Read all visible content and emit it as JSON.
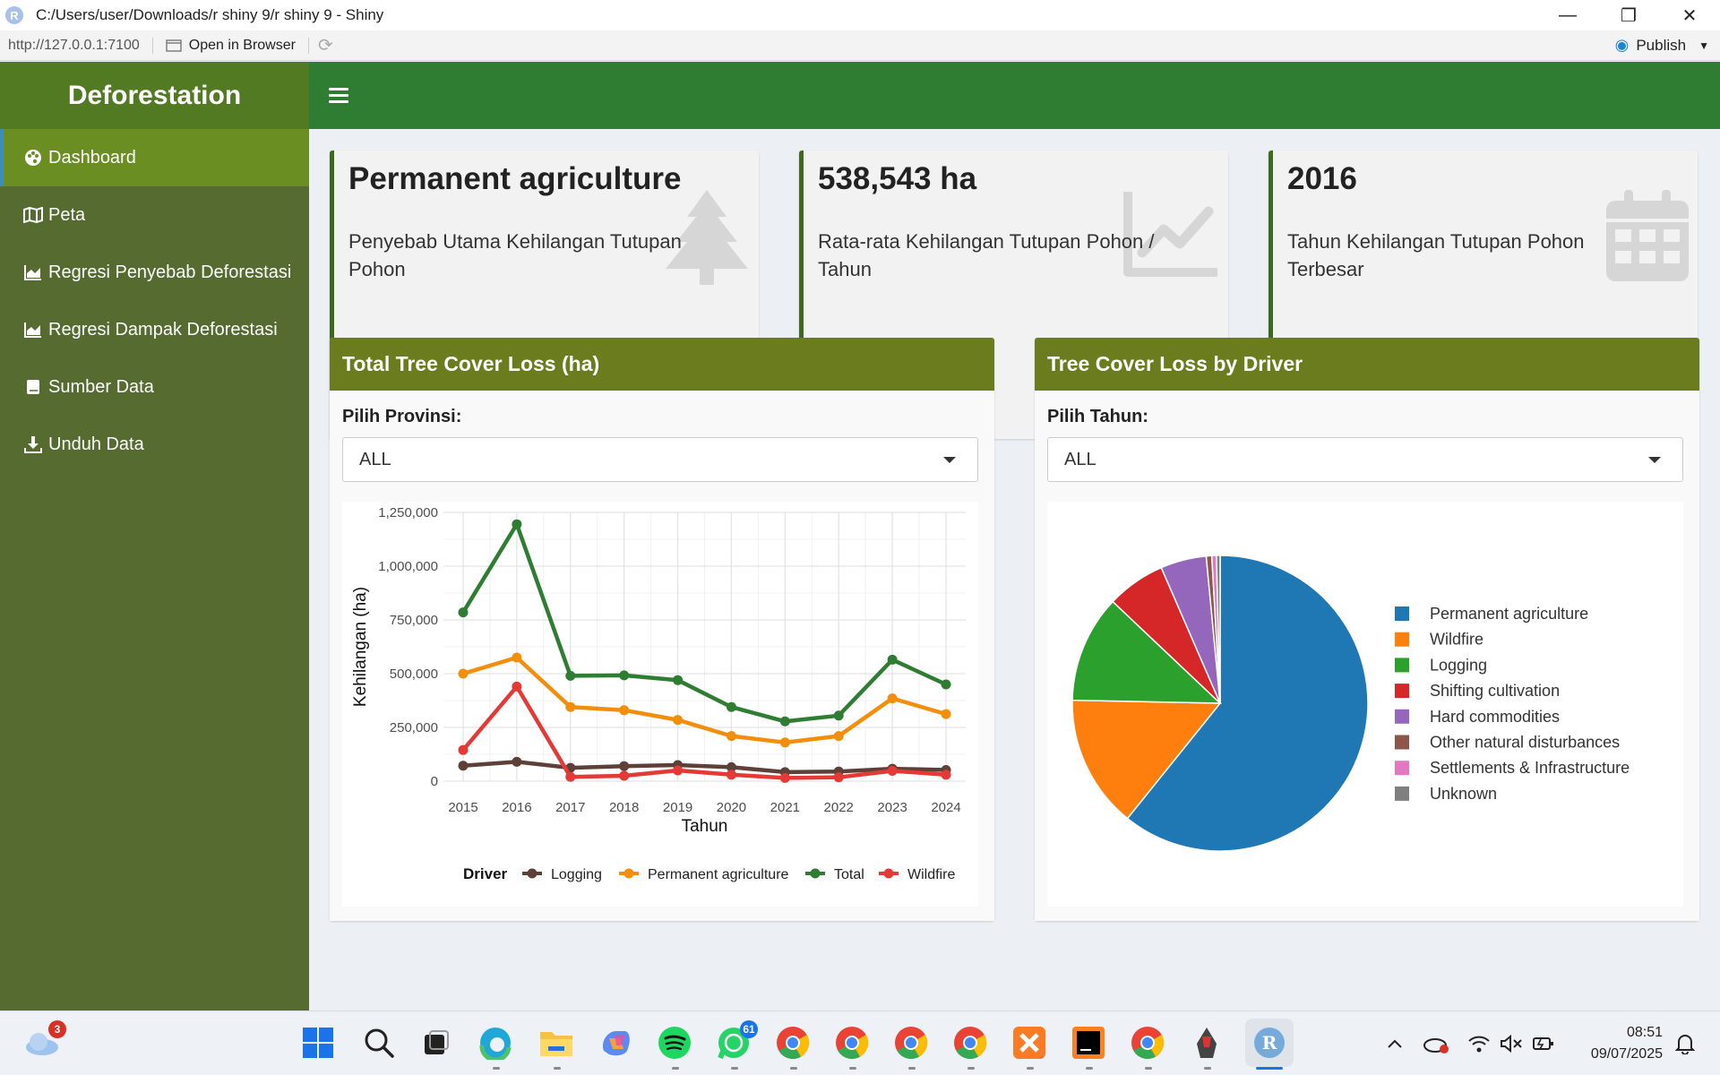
{
  "window": {
    "title": "C:/Users/user/Downloads/r shiny 9/r shiny 9 - Shiny",
    "app_icon_letter": "R",
    "minimize": "—",
    "restore": "❐",
    "close": "✕"
  },
  "addressbar": {
    "url": "http://127.0.0.1:7100",
    "open_in_browser": "Open in Browser",
    "publish": "Publish"
  },
  "app": {
    "brand": "Deforestation"
  },
  "sidebar": {
    "items": [
      {
        "label": "Dashboard",
        "icon": "palette-icon"
      },
      {
        "label": "Peta",
        "icon": "map-icon"
      },
      {
        "label": "Regresi Penyebab Deforestasi",
        "icon": "area-chart-icon"
      },
      {
        "label": "Regresi Dampak Deforestasi",
        "icon": "area-chart-icon"
      },
      {
        "label": "Sumber Data",
        "icon": "book-icon"
      },
      {
        "label": "Unduh Data",
        "icon": "download-icon"
      }
    ]
  },
  "value_boxes": [
    {
      "value": "Permanent agriculture",
      "subtitle": "Penyebab Utama Kehilangan Tutupan Pohon",
      "icon": "tree-icon"
    },
    {
      "value": "538,543 ha",
      "subtitle": "Rata-rata Kehilangan Tutupan Pohon / Tahun",
      "icon": "line-chart-icon"
    },
    {
      "value": "2016",
      "subtitle": "Tahun Kehilangan Tutupan Pohon Terbesar",
      "icon": "calendar-icon"
    }
  ],
  "line_panel": {
    "title": "Total Tree Cover Loss (ha)",
    "select_label": "Pilih Provinsi:",
    "select_value": "ALL"
  },
  "pie_panel": {
    "title": "Tree Cover Loss by Driver",
    "select_label": "Pilih Tahun:",
    "select_value": "ALL"
  },
  "chart_data": [
    {
      "type": "line",
      "title": "",
      "xlabel": "Tahun",
      "ylabel": "Kehilangan (ha)",
      "x": [
        2015,
        2016,
        2017,
        2018,
        2019,
        2020,
        2021,
        2022,
        2023,
        2024
      ],
      "ylim": [
        0,
        1250000
      ],
      "yticks": [
        0,
        250000,
        500000,
        750000,
        1000000,
        1250000
      ],
      "ytick_labels": [
        "0",
        "250,000",
        "500,000",
        "750,000",
        "1,000,000",
        "1,250,000"
      ],
      "grid": true,
      "legend_title": "Driver",
      "legend_position": "bottom",
      "series": [
        {
          "name": "Logging",
          "color": "#5d4037",
          "values": [
            72000,
            90000,
            62000,
            70000,
            75000,
            65000,
            42000,
            45000,
            58000,
            52000
          ]
        },
        {
          "name": "Permanent agriculture",
          "color": "#f28e0c",
          "values": [
            500000,
            575000,
            345000,
            330000,
            285000,
            210000,
            180000,
            210000,
            385000,
            312000
          ]
        },
        {
          "name": "Total",
          "color": "#2e7d32",
          "values": [
            785000,
            1195000,
            490000,
            492000,
            470000,
            345000,
            278000,
            305000,
            565000,
            450000
          ]
        },
        {
          "name": "Wildfire",
          "color": "#e53935",
          "values": [
            145000,
            440000,
            20000,
            25000,
            50000,
            30000,
            15000,
            18000,
            48000,
            30000
          ]
        }
      ]
    },
    {
      "type": "pie",
      "title": "",
      "legend_position": "right",
      "series": [
        {
          "name": "Permanent agriculture",
          "color": "#1f77b4",
          "value": 60.6
        },
        {
          "name": "Wildfire",
          "color": "#ff7f0e",
          "value": 14.5
        },
        {
          "name": "Logging",
          "color": "#2ca02c",
          "value": 11.7
        },
        {
          "name": "Shifting cultivation",
          "color": "#d62728",
          "value": 6.4
        },
        {
          "name": "Hard commodities",
          "color": "#9467bd",
          "value": 5.0
        },
        {
          "name": "Other natural disturbances",
          "color": "#8c564b",
          "value": 0.6
        },
        {
          "name": "Settlements & Infrastructure",
          "color": "#e377c2",
          "value": 0.5
        },
        {
          "name": "Unknown",
          "color": "#7f7f7f",
          "value": 0.4
        }
      ]
    }
  ],
  "taskbar": {
    "weather_badge": "3",
    "whatsapp_badge": "61",
    "time": "08:51",
    "date": "09/07/2025"
  }
}
